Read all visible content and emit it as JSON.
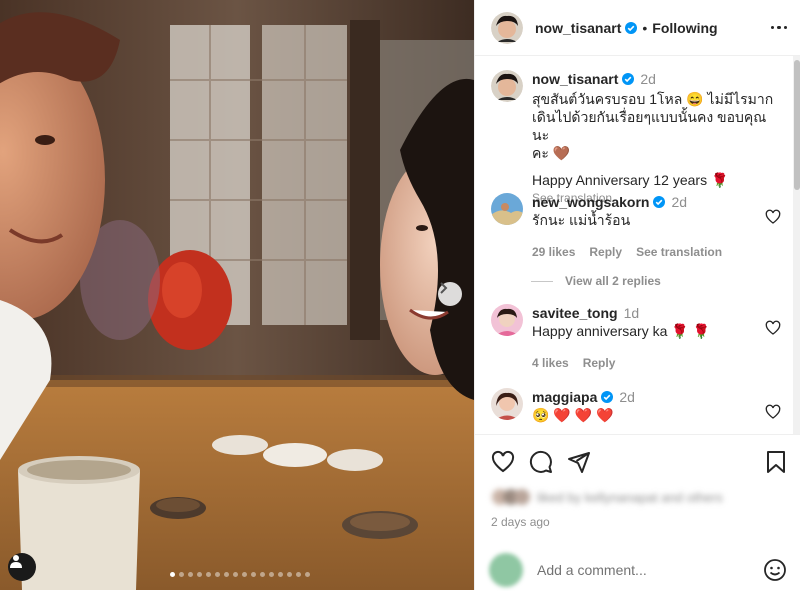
{
  "header": {
    "username": "now_tisanart",
    "separator": "•",
    "follow_label": "Following",
    "more_icon": "more-horizontal-icon"
  },
  "caption": {
    "username": "now_tisanart",
    "time": "2d",
    "text_line1": "สุขสันต์วันครบรอบ 1โหล 😄  ไม่มีไรมาก",
    "text_line2": "เดินไปด้วยกันเรื่อยๆแบบนั้นคง ขอบคุณนะ",
    "text_line3": "คะ 🤎",
    "text_line4": "Happy Anniversary 12 years 🌹",
    "see_translation": "See translation"
  },
  "comments": [
    {
      "username": "new_wongsakorn",
      "verified": true,
      "time": "2d",
      "text": "รักนะ แม่น้ำร้อน",
      "likes": "29 likes",
      "reply": "Reply",
      "see_translation": "See translation"
    },
    {
      "username": "savitee_tong",
      "verified": false,
      "time": "1d",
      "text": "Happy anniversary ka 🌹 🌹",
      "likes": "4 likes",
      "reply": "Reply"
    },
    {
      "username": "maggiapa",
      "verified": true,
      "time": "2d",
      "text": "🥺 ❤️ ❤️ ❤️"
    }
  ],
  "view_replies": "View all 2 replies",
  "actions": {
    "liked_by": "liked by kellynanapat and others",
    "date": "2 days ago"
  },
  "add_comment": {
    "placeholder": "Add a comment..."
  },
  "colors": {
    "verified": "#0095f6",
    "text": "#262626",
    "muted": "#8e8e8e"
  }
}
